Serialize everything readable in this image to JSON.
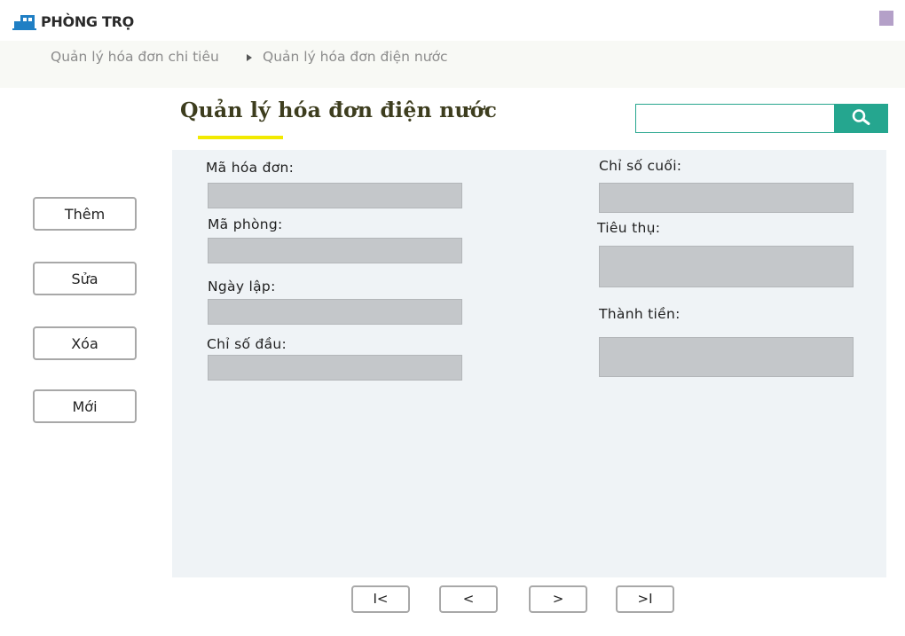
{
  "header": {
    "logo_text": "PHÒNG TRỌ",
    "logo_icon": "house-icon",
    "menu_icon": "menu-square-icon",
    "accent_color": "#b4a0c8"
  },
  "breadcrumb": {
    "items": [
      "Quản lý hóa đơn chi tiêu",
      "Quản lý hóa đơn điện nước"
    ],
    "separator_icon": "triangle-right-icon"
  },
  "page": {
    "title": "Quản lý hóa đơn điện nước",
    "underline_color": "#f2ea00"
  },
  "search": {
    "value": "",
    "placeholder": "",
    "icon": "search-icon",
    "button_color": "#25a68f"
  },
  "actions": {
    "add_label": "Thêm",
    "edit_label": "Sửa",
    "delete_label": "Xóa",
    "new_label": "Mới"
  },
  "form": {
    "ma_hoa_don": {
      "label": "Mã hóa đơn:",
      "value": ""
    },
    "ma_phong": {
      "label": "Mã phòng:",
      "value": ""
    },
    "ngay_lap": {
      "label": "Ngày lập:",
      "value": ""
    },
    "chi_so_dau": {
      "label": "Chỉ số đầu:",
      "value": ""
    },
    "chi_so_cuoi": {
      "label": "Chỉ số cuối:",
      "value": ""
    },
    "tieu_thu": {
      "label": "Tiêu thụ:",
      "value": ""
    },
    "thanh_tien": {
      "label": "Thành tiền:",
      "value": ""
    }
  },
  "pagination": {
    "first_label": "I<",
    "prev_label": "<",
    "next_label": ">",
    "last_label": ">I"
  }
}
